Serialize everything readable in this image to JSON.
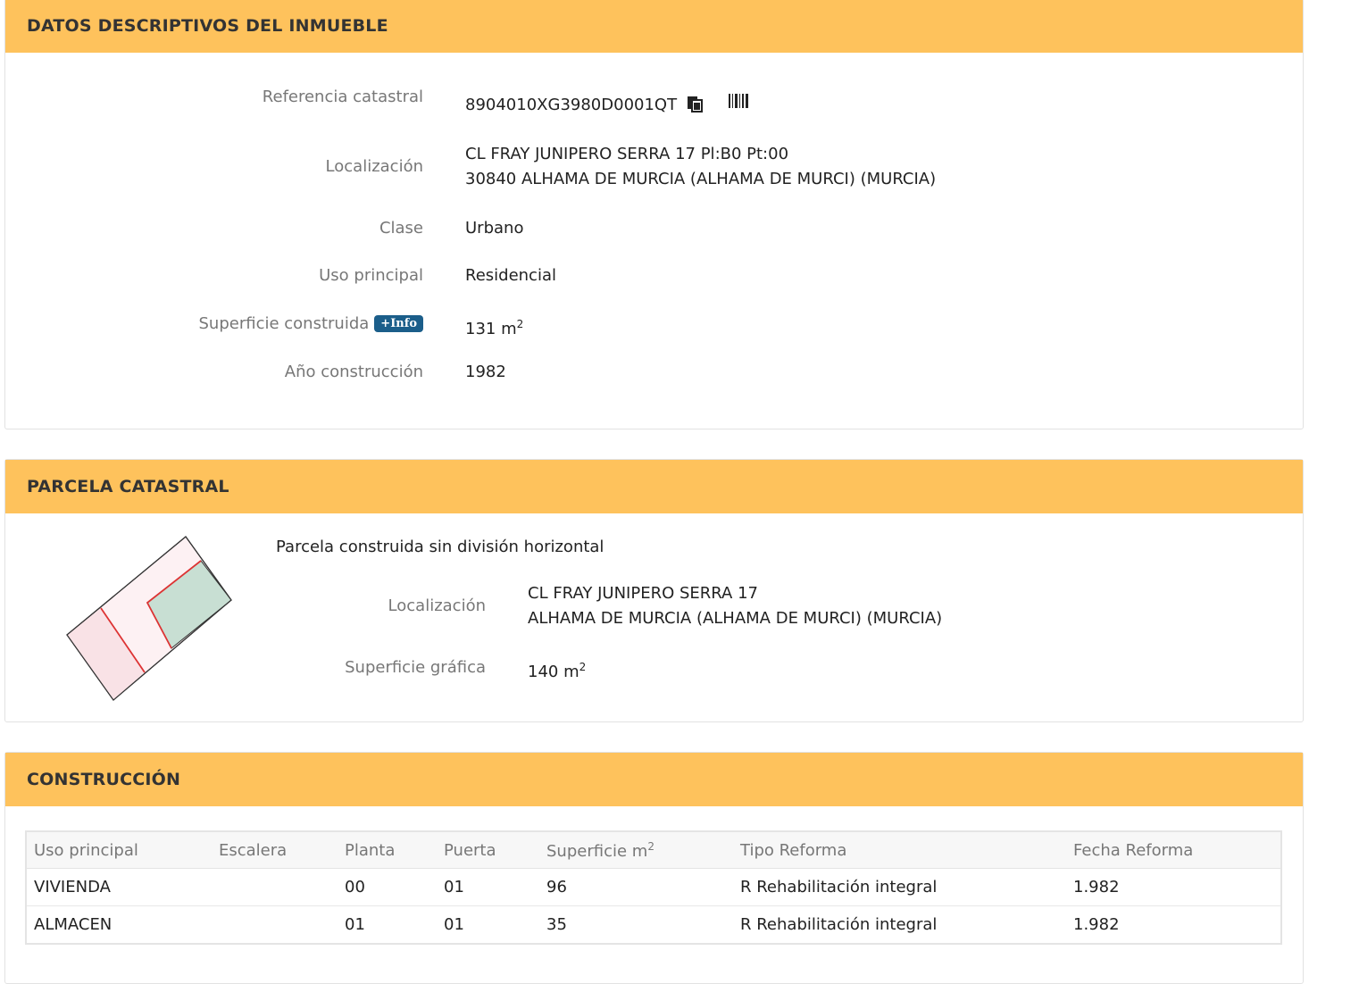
{
  "inmueble": {
    "header": "DATOS DESCRIPTIVOS DEL INMUEBLE",
    "ref_label": "Referencia catastral",
    "ref_value": "8904010XG3980D0001QT",
    "loc_label": "Localización",
    "loc_line1": "CL FRAY JUNIPERO SERRA 17 Pl:B0 Pt:00",
    "loc_line2": "30840 ALHAMA DE MURCIA (ALHAMA DE MURCI) (MURCIA)",
    "clase_label": "Clase",
    "clase_value": "Urbano",
    "uso_label": "Uso principal",
    "uso_value": "Residencial",
    "sup_label": "Superficie construida",
    "sup_badge": "+Info",
    "sup_value": "131 m",
    "sup_exp": "2",
    "anio_label": "Año construcción",
    "anio_value": "1982"
  },
  "parcela": {
    "header": "PARCELA CATASTRAL",
    "descripcion": "Parcela construida sin división horizontal",
    "loc_label": "Localización",
    "loc_line1": "CL FRAY JUNIPERO SERRA 17",
    "loc_line2": "ALHAMA DE MURCIA (ALHAMA DE MURCI) (MURCIA)",
    "sup_label": "Superficie gráfica",
    "sup_value": "140 m",
    "sup_exp": "2"
  },
  "construccion": {
    "header": "CONSTRUCCIÓN",
    "columns": [
      "Uso principal",
      "Escalera",
      "Planta",
      "Puerta",
      "Superficie m",
      "Tipo Reforma",
      "Fecha Reforma"
    ],
    "sup_exp": "2",
    "rows": [
      [
        "VIVIENDA",
        "",
        "00",
        "01",
        "96",
        "R Rehabilitación integral",
        "1.982"
      ],
      [
        "ALMACEN",
        "",
        "01",
        "01",
        "35",
        "R Rehabilitación integral",
        "1.982"
      ]
    ]
  },
  "colors": {
    "header_bg": "#fec25c",
    "badge_bg": "#1b5e8a"
  }
}
